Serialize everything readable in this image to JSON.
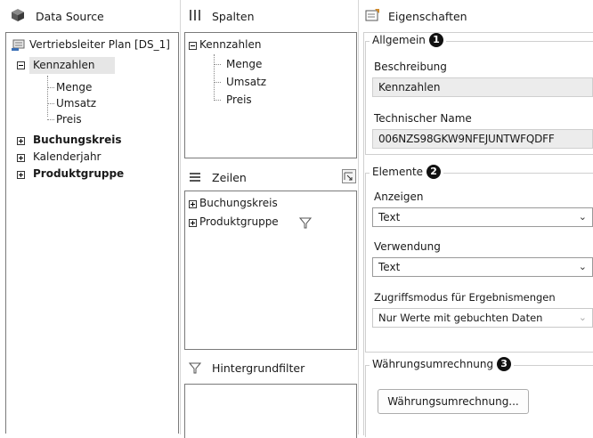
{
  "data_source": {
    "header": "Data Source",
    "root_label": "Vertriebsleiter Plan [DS_1]",
    "kennzahlen": "Kennzahlen",
    "measures": [
      "Menge",
      "Umsatz",
      "Preis"
    ],
    "buchungskreis": "Buchungskreis",
    "kalenderjahr": "Kalenderjahr",
    "produktgruppe": "Produktgruppe"
  },
  "spalten": {
    "header": "Spalten",
    "kennzahlen": "Kennzahlen",
    "measures": [
      "Menge",
      "Umsatz",
      "Preis"
    ]
  },
  "zeilen": {
    "header": "Zeilen",
    "items": [
      "Buchungskreis",
      "Produktgruppe"
    ]
  },
  "hintergrundfilter": {
    "header": "Hintergrundfilter"
  },
  "eigenschaften": {
    "header": "Eigenschaften",
    "allgemein": {
      "title": "Allgemein",
      "badge": "1",
      "beschreibung_label": "Beschreibung",
      "beschreibung_value": "Kennzahlen",
      "techname_label": "Technischer Name",
      "techname_value": "006NZS98GKW9NFEJUNTWFQDFF"
    },
    "elemente": {
      "title": "Elemente",
      "badge": "2",
      "anzeigen_label": "Anzeigen",
      "anzeigen_value": "Text",
      "verwendung_label": "Verwendung",
      "verwendung_value": "Text",
      "zugriff_label": "Zugriffsmodus für Ergebnismengen",
      "zugriff_value": "Nur Werte mit gebuchten Daten"
    },
    "waehrung": {
      "title": "Währungsumrechnung",
      "badge": "3",
      "button_label": "Währungsumrechnung..."
    }
  }
}
